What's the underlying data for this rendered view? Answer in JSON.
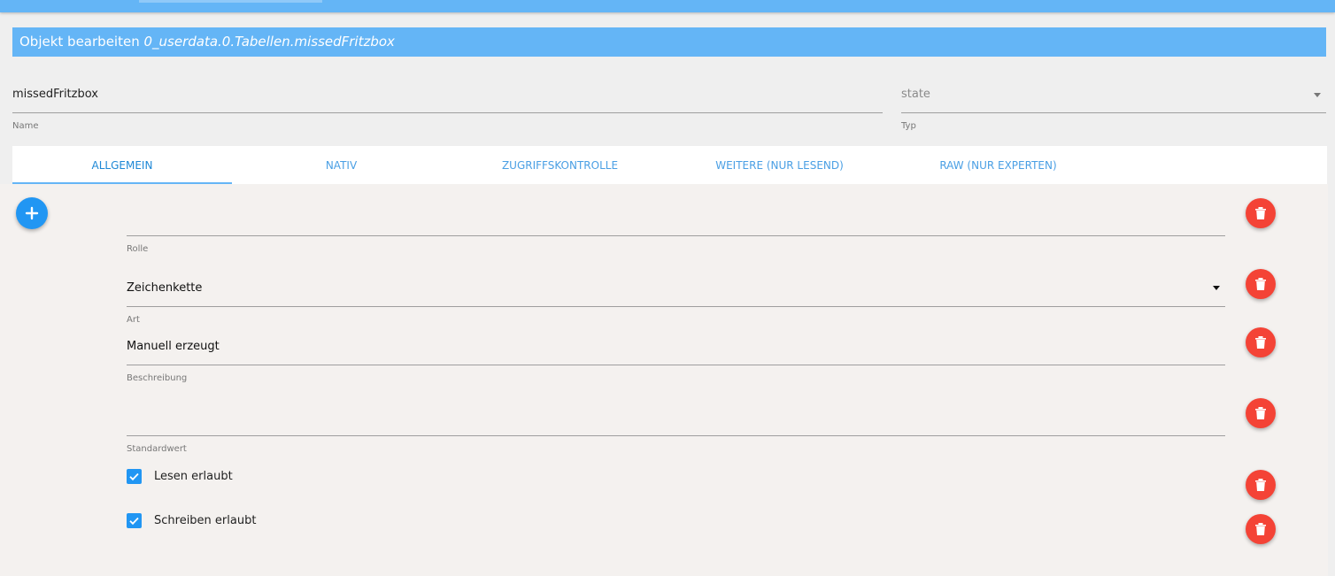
{
  "dialog": {
    "title_prefix": "Objekt bearbeiten",
    "title_path": "0_userdata.0.Tabellen.missedFritzbox"
  },
  "name_field": {
    "value": "missedFritzbox",
    "label": "Name"
  },
  "type_field": {
    "value": "state",
    "label": "Typ"
  },
  "tabs": [
    {
      "label": "ALLGEMEIN",
      "active": true
    },
    {
      "label": "NATIV",
      "active": false
    },
    {
      "label": "ZUGRIFFSKONTROLLE",
      "active": false
    },
    {
      "label": "WEITERE (NUR LESEND)",
      "active": false
    },
    {
      "label": "RAW (NUR EXPERTEN)",
      "active": false
    }
  ],
  "fields": {
    "rolle": {
      "value": "",
      "label": "Rolle"
    },
    "art": {
      "value": "Zeichenkette",
      "label": "Art"
    },
    "beschreibung": {
      "value": "Manuell erzeugt",
      "label": "Beschreibung"
    },
    "standardwert": {
      "value": "",
      "label": "Standardwert"
    }
  },
  "checkboxes": {
    "read": {
      "label": "Lesen erlaubt",
      "checked": true
    },
    "write": {
      "label": "Schreiben erlaubt",
      "checked": true
    }
  },
  "icons": {
    "add": "plus-icon",
    "delete": "trash-icon",
    "dropdown": "caret-down-icon",
    "check": "check-icon"
  },
  "colors": {
    "header_blue": "#64b5f6",
    "accent_blue": "#2196f3",
    "delete_red": "#f44336"
  }
}
